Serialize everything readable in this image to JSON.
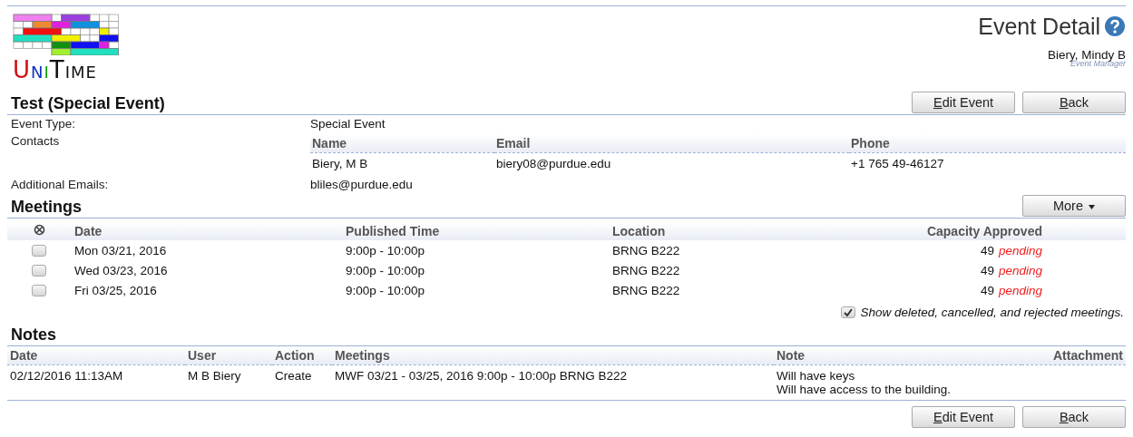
{
  "header": {
    "logo_text": "UniTime",
    "page_title": "Event Detail",
    "user_name": "Biery, Mindy B",
    "user_role": "Event Manager"
  },
  "event": {
    "title": "Test (Special Event)",
    "buttons": [
      {
        "label": "Edit Event",
        "underline_first": true
      },
      {
        "label": "Back",
        "underline_first": true
      }
    ]
  },
  "details": [
    {
      "kind": "text",
      "label": "Event Type:",
      "value": "Special Event"
    },
    {
      "kind": "contacts",
      "label": "Contacts",
      "columns": [
        "Name",
        "Email",
        "Phone"
      ],
      "rows": [
        [
          "Biery, M B",
          "biery08@purdue.edu",
          "+1 765 49-46127"
        ]
      ]
    },
    {
      "kind": "text",
      "label": "Additional Emails:",
      "value": "bliles@purdue.edu"
    }
  ],
  "meetings": {
    "title": "Meetings",
    "more_button": {
      "label": "More",
      "underline_first": false
    },
    "columns": [
      "Date",
      "Published Time",
      "Location",
      "Capacity Approved"
    ],
    "rows": [
      {
        "checked": false,
        "date": "Mon 03/21, 2016",
        "time": "9:00p - 10:00p",
        "location": "BRNG B222",
        "capacity": "49",
        "approval": "pending"
      },
      {
        "checked": false,
        "date": "Wed 03/23, 2016",
        "time": "9:00p - 10:00p",
        "location": "BRNG B222",
        "capacity": "49",
        "approval": "pending"
      },
      {
        "checked": false,
        "date": "Fri 03/25, 2016",
        "time": "9:00p - 10:00p",
        "location": "BRNG B222",
        "capacity": "49",
        "approval": "pending"
      }
    ],
    "show_deleted": {
      "checked": true,
      "label": "Show deleted, cancelled, and rejected meetings."
    }
  },
  "notes": {
    "title": "Notes",
    "columns": [
      "Date",
      "User",
      "Action",
      "Meetings",
      "Note",
      "Attachment"
    ],
    "rows": [
      {
        "date": "02/12/2016 11:13AM",
        "user": "M B Biery",
        "action": "Create",
        "meetings": "MWF 03/21 - 03/25, 2016 9:00p - 10:00p BRNG B222",
        "note": [
          "Will have keys",
          "Will have access to the building."
        ]
      }
    ]
  },
  "footer_buttons": [
    {
      "label": "Edit Event",
      "underline_first": true
    },
    {
      "label": "Back",
      "underline_first": true
    }
  ]
}
